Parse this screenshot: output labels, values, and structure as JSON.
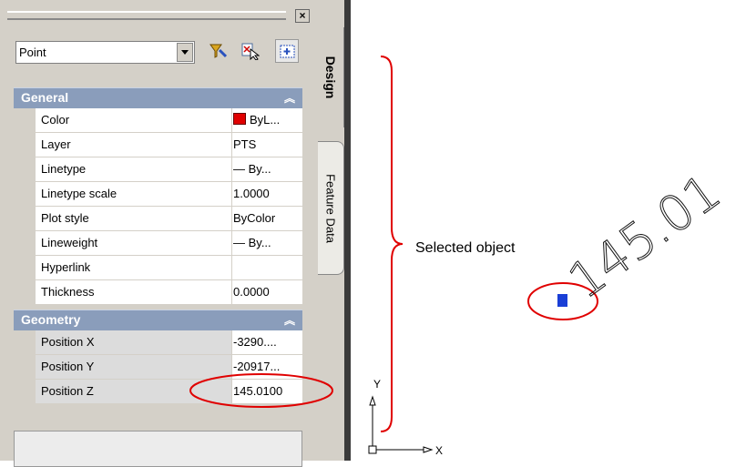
{
  "palette": {
    "object_type": "Point",
    "close_glyph": "×",
    "toolbar": [
      "quick-select-icon",
      "select-objects-icon",
      "toggle-pickadd-icon"
    ],
    "sections": {
      "general": {
        "title": "General",
        "rows": [
          {
            "label": "Color",
            "value": "ByL..."
          },
          {
            "label": "Layer",
            "value": "PTS"
          },
          {
            "label": "Linetype",
            "value": "— By..."
          },
          {
            "label": "Linetype scale",
            "value": "1.0000"
          },
          {
            "label": "Plot style",
            "value": "ByColor"
          },
          {
            "label": "Lineweight",
            "value": "— By..."
          },
          {
            "label": "Hyperlink",
            "value": ""
          },
          {
            "label": "Thickness",
            "value": "0.0000"
          }
        ]
      },
      "geometry": {
        "title": "Geometry",
        "rows": [
          {
            "label": "Position X",
            "value": "-3290...."
          },
          {
            "label": "Position Y",
            "value": "-20917..."
          },
          {
            "label": "Position Z",
            "value": "145.0100"
          }
        ]
      }
    },
    "tabs": {
      "design": "Design",
      "feature_data": "Feature Data"
    },
    "collapse_glyph": "«"
  },
  "canvas": {
    "selected_label": "Selected object",
    "elevation_text": "145.01",
    "ucs": {
      "y": "Y",
      "x": "X"
    }
  },
  "colors": {
    "highlight": "#e00000",
    "point": "#1a3fd6",
    "section_header": "#8a9dbb"
  }
}
